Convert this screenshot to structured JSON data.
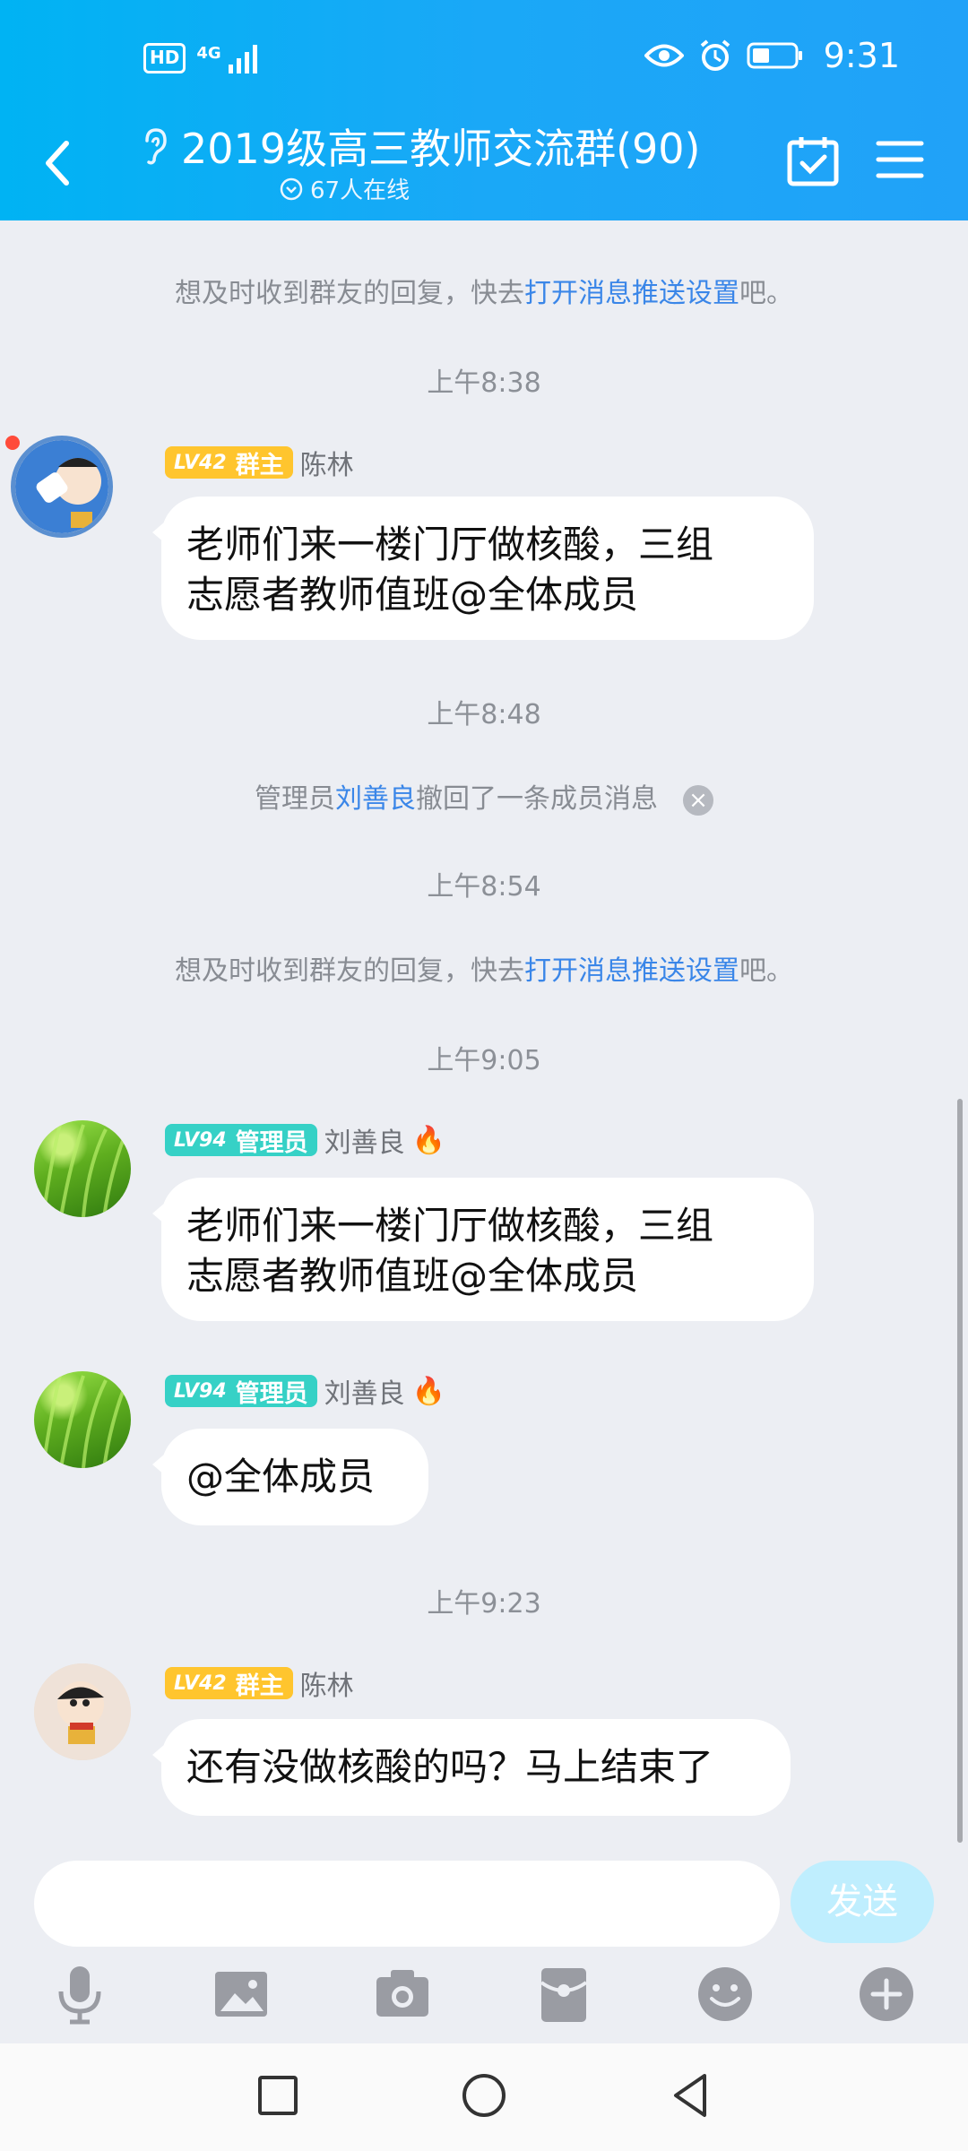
{
  "statusbar": {
    "hd": "HD",
    "network": "4G",
    "time": "9:31"
  },
  "header": {
    "title": "2019级高三教师交流群(90)",
    "online": "67人在线"
  },
  "notices": [
    {
      "pre": "想及时收到群友的回复，快去",
      "link": "打开消息推送设置",
      "post": "吧。"
    },
    {
      "pre": "想及时收到群友的回复，快去",
      "link": "打开消息推送设置",
      "post": "吧。"
    }
  ],
  "times": [
    "上午8:38",
    "上午8:48",
    "上午8:54",
    "上午9:05",
    "上午9:23"
  ],
  "recall": {
    "pre": "管理员",
    "name": "刘善良",
    "post": "撤回了一条成员消息"
  },
  "messages": [
    {
      "lv": "LV42",
      "role": "群主",
      "sender": "陈林",
      "text_l1": "老师们来一楼门厅做核酸，三组",
      "text_l2": "志愿者教师值班@全体成员"
    },
    {
      "lv": "LV94",
      "role": "管理员",
      "sender": "刘善良",
      "text_l1": "老师们来一楼门厅做核酸，三组",
      "text_l2": "志愿者教师值班@全体成员"
    },
    {
      "lv": "LV94",
      "role": "管理员",
      "sender": "刘善良",
      "text": "@全体成员"
    },
    {
      "lv": "LV42",
      "role": "群主",
      "sender": "陈林",
      "text": "还有没做核酸的吗？马上结束了"
    }
  ],
  "input": {
    "placeholder": "",
    "send_label": "发送"
  },
  "toolbar": [
    "mic-icon",
    "image-icon",
    "camera-icon",
    "red-packet-icon",
    "emoji-icon",
    "plus-icon"
  ],
  "navbar": [
    "recent-apps-icon",
    "home-icon",
    "back-icon"
  ],
  "colors": {
    "header": "#1aa8f7",
    "link": "#3a86e8",
    "owner_badge": "#ffc52e",
    "admin_badge": "#36d1c6",
    "send_btn": "#bfeefe"
  }
}
